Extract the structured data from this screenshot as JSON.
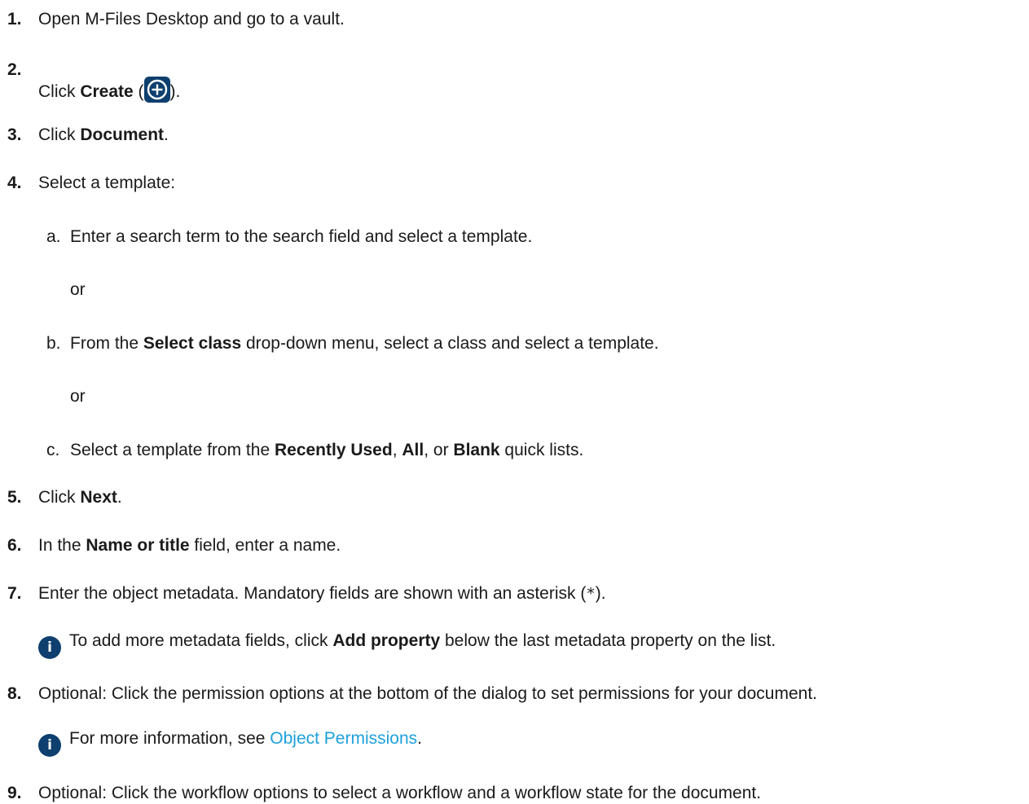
{
  "steps": [
    {
      "num": "1.",
      "text": "Open M-Files Desktop and go to a vault."
    },
    {
      "num": "2.",
      "pre": "Click ",
      "bold": "Create",
      "mid": " (",
      "icon": "plus-circle-icon",
      "post": ")."
    },
    {
      "num": "3.",
      "pre": "Click ",
      "bold": "Document",
      "post": "."
    },
    {
      "num": "4.",
      "text": "Select a template:"
    },
    {
      "num": "5.",
      "pre": "Click ",
      "bold": "Next",
      "post": "."
    },
    {
      "num": "6.",
      "pre": "In the ",
      "bold": "Name or title",
      "post": " field, enter a name."
    },
    {
      "num": "7.",
      "pre": "Enter the object metadata. Mandatory fields are shown with an asterisk (",
      "code": "*",
      "post": ")."
    },
    {
      "num": "8.",
      "text": "Optional: Click the permission options at the bottom of the dialog to set permissions for your document."
    },
    {
      "num": "9.",
      "text": "Optional: Click the workflow options to select a workflow and a workflow state for the document."
    }
  ],
  "substeps": [
    {
      "letter": "a.",
      "text": "Enter a search term to the search field and select a template."
    },
    {
      "letter": "b.",
      "pre": "From the ",
      "bold": "Select class",
      "post": " drop-down menu, select a class and select a template."
    },
    {
      "letter": "c.",
      "pre": "Select a template from the ",
      "b1": "Recently Used",
      "s1": ", ",
      "b2": "All",
      "s2": ", or ",
      "b3": "Blank",
      "post": " quick lists."
    }
  ],
  "or_text": "or",
  "notes": [
    {
      "icon": "info-icon",
      "pre": "To add more metadata fields, click ",
      "bold": "Add property",
      "post": " below the last metadata property on the list."
    },
    {
      "icon": "info-icon",
      "pre": "For more information, see ",
      "link": "Object Permissions",
      "post": "."
    }
  ],
  "colors": {
    "text": "#1a1a1a",
    "icon_bg": "#0e3f6e",
    "link": "#1ea0dc"
  }
}
